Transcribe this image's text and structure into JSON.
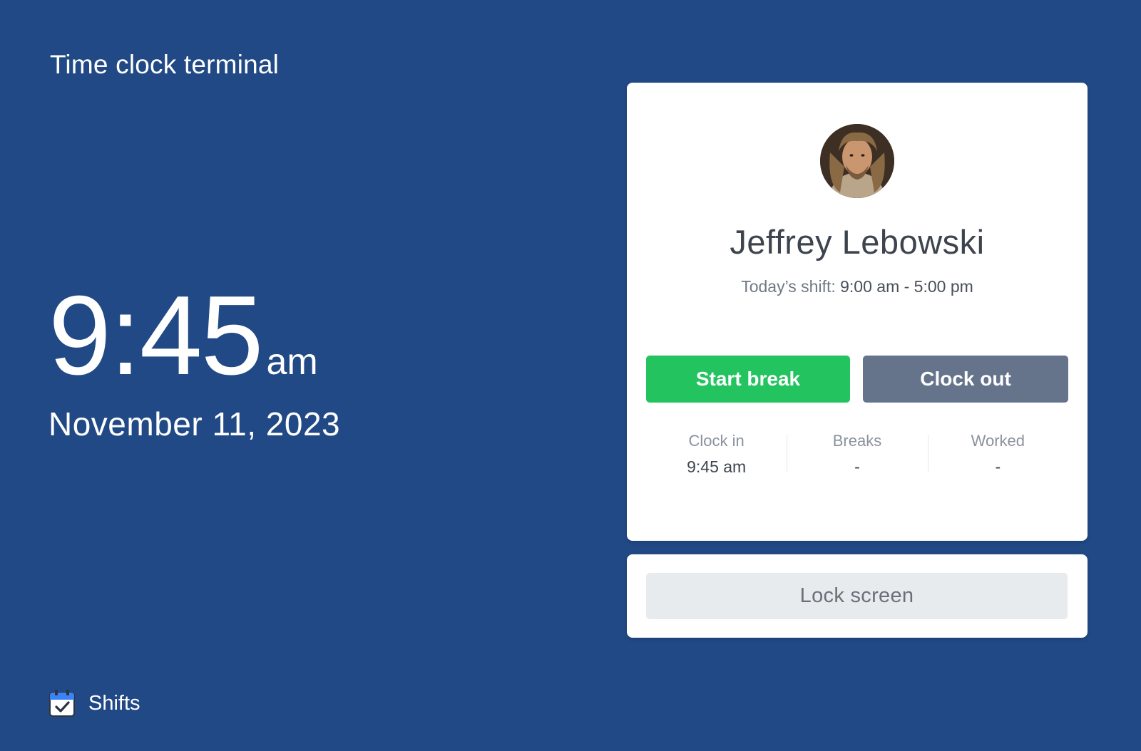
{
  "app": {
    "title": "Time clock terminal"
  },
  "clock": {
    "time": "9:45",
    "meridiem": "am",
    "date": "November 11, 2023"
  },
  "footer": {
    "shifts_label": "Shifts",
    "shifts_icon": "calendar-check-icon"
  },
  "employee": {
    "name": "Jeffrey Lebowski",
    "avatar_icon": "user-avatar",
    "shift_prefix": "Today’s shift:",
    "shift_hours": "9:00 am - 5:00 pm"
  },
  "actions": {
    "start_break_label": "Start break",
    "clock_out_label": "Clock out",
    "lock_screen_label": "Lock screen"
  },
  "stats": [
    {
      "label": "Clock in",
      "value": "9:45 am"
    },
    {
      "label": "Breaks",
      "value": "-"
    },
    {
      "label": "Worked",
      "value": "-"
    }
  ],
  "colors": {
    "background": "#214985",
    "start_break": "#23c35f",
    "clock_out": "#66748b",
    "lock_screen": "#e8ebee",
    "card": "#ffffff"
  }
}
